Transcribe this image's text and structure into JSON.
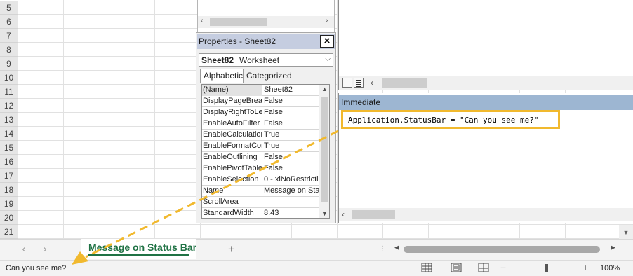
{
  "excel": {
    "row_numbers": [
      "5",
      "6",
      "7",
      "8",
      "9",
      "10",
      "11",
      "12",
      "13",
      "14",
      "15",
      "16",
      "17",
      "18",
      "19",
      "20",
      "21"
    ],
    "sheet_tab": "Message on Status Bar",
    "status_text": "Can you see me?",
    "zoom_level": "100%",
    "zoom_minus": "−",
    "zoom_plus": "+",
    "add_sheet": "+"
  },
  "properties": {
    "title": "Properties - Sheet82",
    "close": "×",
    "object_name": "Sheet82",
    "object_type": "Worksheet",
    "tabs": [
      "Alphabetic",
      "Categorized"
    ],
    "rows": [
      {
        "name": "(Name)",
        "value": "Sheet82"
      },
      {
        "name": "DisplayPageBreak",
        "value": "False"
      },
      {
        "name": "DisplayRightToLef",
        "value": "False"
      },
      {
        "name": "EnableAutoFilter",
        "value": "False"
      },
      {
        "name": "EnableCalculation",
        "value": "True"
      },
      {
        "name": "EnableFormatCon",
        "value": "True"
      },
      {
        "name": "EnableOutlining",
        "value": "False"
      },
      {
        "name": "EnablePivotTable",
        "value": "False"
      },
      {
        "name": "EnableSelection",
        "value": "0 - xlNoRestricti"
      },
      {
        "name": "Name",
        "value": "Message on Sta"
      },
      {
        "name": "ScrollArea",
        "value": ""
      },
      {
        "name": "StandardWidth",
        "value": "8.43"
      }
    ]
  },
  "immediate": {
    "title": "Immediate",
    "code": "Application.StatusBar = \"Can you see me?\""
  },
  "colors": {
    "highlight": "#f1b92e",
    "excel_green": "#1f7244",
    "immediate_title": "#9db6d2"
  }
}
